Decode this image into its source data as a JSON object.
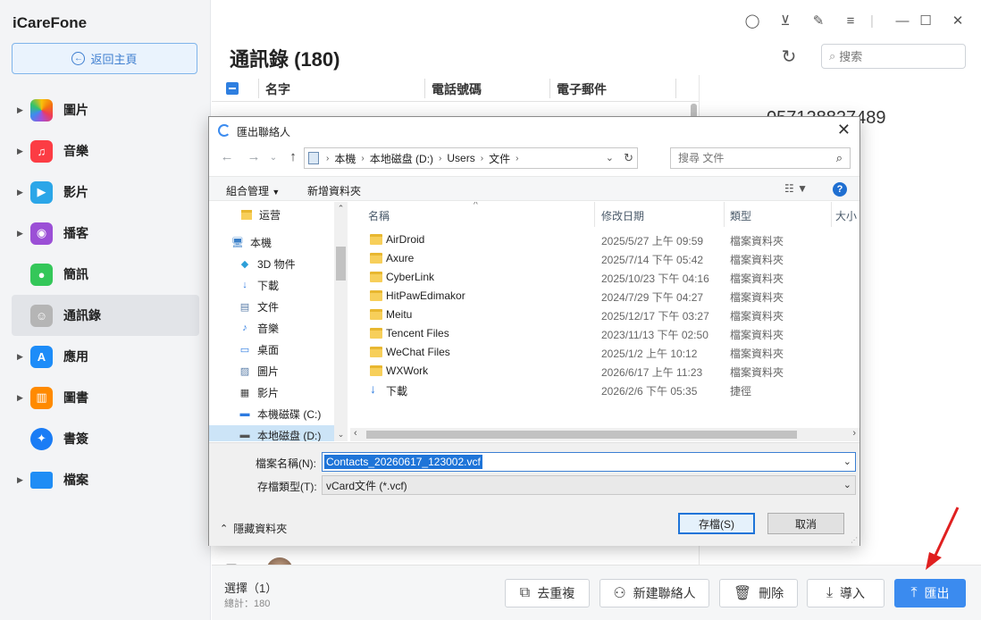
{
  "app": {
    "title": "iCareFone",
    "home_label": "返回主頁"
  },
  "sidebar": {
    "items": [
      {
        "label": "圖片",
        "icon": "photos-icon",
        "color": "#ffffff",
        "expandable": true
      },
      {
        "label": "音樂",
        "icon": "music-icon",
        "color": "#fc3c44",
        "expandable": true
      },
      {
        "label": "影片",
        "icon": "video-icon",
        "color": "#2ba6e8",
        "expandable": true
      },
      {
        "label": "播客",
        "icon": "podcast-icon",
        "color": "#9b4fd6",
        "expandable": true
      },
      {
        "label": "簡訊",
        "icon": "messages-icon",
        "color": "#34c759",
        "expandable": false
      },
      {
        "label": "通訊錄",
        "icon": "contacts-icon",
        "color": "#b5b5b5",
        "expandable": false,
        "active": true
      },
      {
        "label": "應用",
        "icon": "appstore-icon",
        "color": "#1d8cf8",
        "expandable": true
      },
      {
        "label": "圖書",
        "icon": "books-icon",
        "color": "#ff8a00",
        "expandable": true
      },
      {
        "label": "書簽",
        "icon": "safari-icon",
        "color": "#1a7cf5",
        "expandable": false
      },
      {
        "label": "檔案",
        "icon": "files-icon",
        "color": "#1f8df5",
        "expandable": true
      }
    ]
  },
  "main": {
    "title": "通訊錄 (180)",
    "search_placeholder": "搜索",
    "columns": [
      "名字",
      "電話號碼",
      "電子郵件"
    ],
    "detail_phone": "057128827489"
  },
  "bottom": {
    "selected": "選擇（1）",
    "total": "總計：180",
    "buttons": {
      "dedupe": "去重複",
      "new_contact": "新建聯絡人",
      "delete": "刪除",
      "import": "導入",
      "export": "匯出"
    }
  },
  "dialog": {
    "title": "匯出聯絡人",
    "path": [
      "本機",
      "本地磁盘 (D:)",
      "Users",
      "文件"
    ],
    "search_placeholder": "搜尋 文件",
    "organize": "組合管理",
    "new_folder": "新增資料夾",
    "tree": [
      {
        "label": "运营",
        "icon": "folder-icon"
      },
      {
        "label": "本機",
        "icon": "computer-icon"
      },
      {
        "label": "3D 物件",
        "icon": "3d-objects-icon"
      },
      {
        "label": "下載",
        "icon": "download-icon"
      },
      {
        "label": "文件",
        "icon": "document-icon"
      },
      {
        "label": "音樂",
        "icon": "music-note-icon"
      },
      {
        "label": "桌面",
        "icon": "desktop-icon"
      },
      {
        "label": "圖片",
        "icon": "pictures-icon"
      },
      {
        "label": "影片",
        "icon": "film-icon"
      },
      {
        "label": "本機磁碟 (C:)",
        "icon": "drive-icon"
      },
      {
        "label": "本地磁盘 (D:)",
        "icon": "drive-icon",
        "selected": true
      }
    ],
    "headers": {
      "name": "名稱",
      "date": "修改日期",
      "type": "類型",
      "size": "大小"
    },
    "files": [
      {
        "name": "AirDroid",
        "date": "2025/5/27 上午 09:59",
        "type": "檔案資料夾",
        "kind": "folder"
      },
      {
        "name": "Axure",
        "date": "2025/7/14 下午 05:42",
        "type": "檔案資料夾",
        "kind": "folder"
      },
      {
        "name": "CyberLink",
        "date": "2025/10/23 下午 04:16",
        "type": "檔案資料夾",
        "kind": "folder"
      },
      {
        "name": "HitPawEdimakor",
        "date": "2024/7/29 下午 04:27",
        "type": "檔案資料夾",
        "kind": "folder"
      },
      {
        "name": "Meitu",
        "date": "2025/12/17 下午 03:27",
        "type": "檔案資料夾",
        "kind": "folder"
      },
      {
        "name": "Tencent Files",
        "date": "2023/11/13 下午 02:50",
        "type": "檔案資料夾",
        "kind": "folder"
      },
      {
        "name": "WeChat Files",
        "date": "2025/1/2 上午 10:12",
        "type": "檔案資料夾",
        "kind": "folder"
      },
      {
        "name": "WXWork",
        "date": "2026/6/17 上午 11:23",
        "type": "檔案資料夾",
        "kind": "folder"
      },
      {
        "name": "下載",
        "date": "2026/2/6 下午 05:35",
        "type": "捷徑",
        "kind": "shortcut"
      }
    ],
    "filename_label": "檔案名稱(N):",
    "filename_value": "Contacts_20260617_123002.vcf",
    "filetype_label": "存檔類型(T):",
    "filetype_value": "vCard文件 (*.vcf)",
    "hide_folders": "隱藏資料夾",
    "save": "存檔(S)",
    "cancel": "取消"
  },
  "colors": {
    "accent": "#3b8bef",
    "annotation_arrow": "#e02020"
  }
}
